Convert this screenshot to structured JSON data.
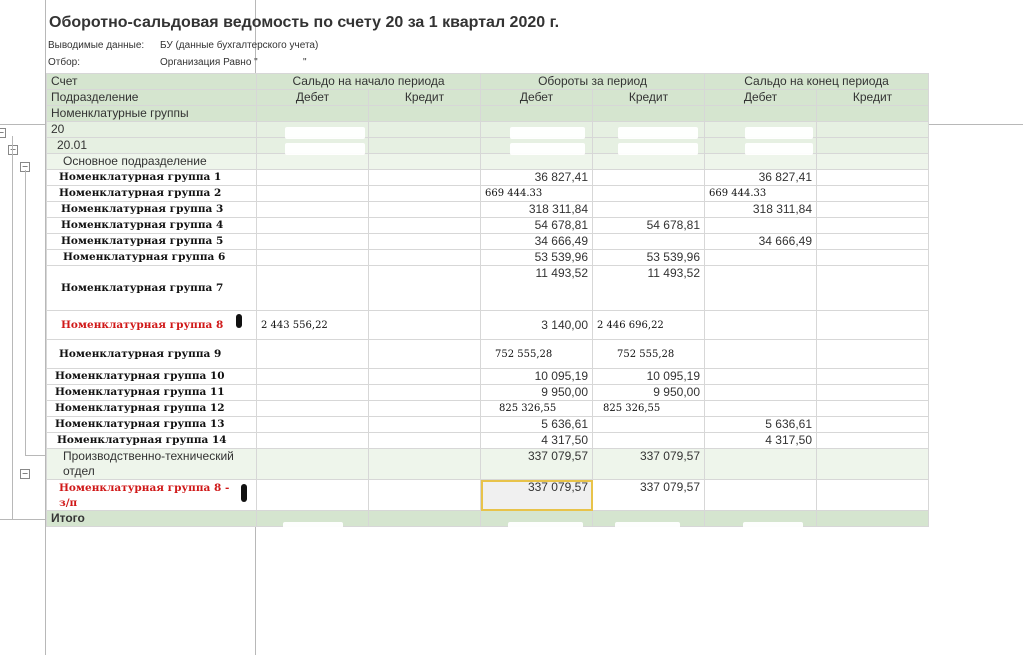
{
  "report": {
    "title": "Оборотно-сальдовая ведомость по счету 20 за 1 квартал 2020 г.",
    "output_label": "Выводимые данные:",
    "output_value": "БУ (данные бухгалтерского учета)",
    "filter_label": "Отбор:",
    "filter_value": "Организация Равно \"",
    "filter_tail": "\""
  },
  "header": {
    "col_account": "Счет",
    "col_division": "Подразделение",
    "col_nomgroups": "Номенклатурные группы",
    "group_open": "Сальдо на начало периода",
    "group_turn": "Обороты за период",
    "group_close": "Сальдо на конец периода",
    "debit": "Дебет",
    "credit": "Кредит"
  },
  "rows": {
    "account": "20",
    "subaccount": "20.01",
    "division1": "Основное подразделение",
    "division2_line1": "Производственно-технический",
    "division2_line2": "отдел",
    "division2_turn_debit": "337 079,57",
    "division2_turn_credit": "337 079,57",
    "total_label": "Итого"
  },
  "items": [
    {
      "name": "Номенклатурная группа 1",
      "turn_debit": "36 827,41",
      "turn_credit": "",
      "close_debit": "36 827,41"
    },
    {
      "name": "Номенклатурная группа 2",
      "turn_debit": "669 444.33",
      "turn_credit": "",
      "close_debit": "669 444.33"
    },
    {
      "name": "Номенклатурная группа 3",
      "turn_debit": "318 311,84",
      "turn_credit": "",
      "close_debit": "318 311,84"
    },
    {
      "name": "Номенклатурная группа 4",
      "turn_debit": "54 678,81",
      "turn_credit": "54 678,81",
      "close_debit": ""
    },
    {
      "name": "Номенклатурная группа 5",
      "turn_debit": "34 666,49",
      "turn_credit": "",
      "close_debit": "34 666,49"
    },
    {
      "name": "Номенклатурная группа 6",
      "turn_debit": "53 539,96",
      "turn_credit": "53 539,96",
      "close_debit": ""
    },
    {
      "name": "Номенклатурная группа 7",
      "turn_debit": "11 493,52",
      "turn_credit": "11 493,52",
      "close_debit": ""
    },
    {
      "name": "Номенклатурная группа 8",
      "open_debit": "2 443 556,22",
      "turn_debit": "3 140,00",
      "turn_credit": "2 446 696,22",
      "close_debit": ""
    },
    {
      "name": "Номенклатурная группа 9",
      "turn_debit": "752 555,28",
      "turn_credit": "752 555,28",
      "close_debit": ""
    },
    {
      "name": "Номенклатурная группа 10",
      "turn_debit": "10 095,19",
      "turn_credit": "10 095,19",
      "close_debit": ""
    },
    {
      "name": "Номенклатурная группа 11",
      "turn_debit": "9 950,00",
      "turn_credit": "9 950,00",
      "close_debit": ""
    },
    {
      "name": "Номенклатурная группа 12",
      "turn_debit": "825 326,55",
      "turn_credit": "825 326,55",
      "close_debit": ""
    },
    {
      "name": "Номенклатурная группа 13",
      "turn_debit": "5 636,61",
      "turn_credit": "",
      "close_debit": "5 636,61"
    },
    {
      "name": "Номенклатурная группа 14",
      "turn_debit": "4 317,50",
      "turn_credit": "",
      "close_debit": "4 317,50"
    }
  ],
  "item_last": {
    "name_line1": "Номенклатурная группа 8 -",
    "name_line2": "з/п",
    "turn_debit": "337 079,57",
    "turn_credit": "337 079,57"
  },
  "tree": {
    "expand_glyph": "−"
  }
}
